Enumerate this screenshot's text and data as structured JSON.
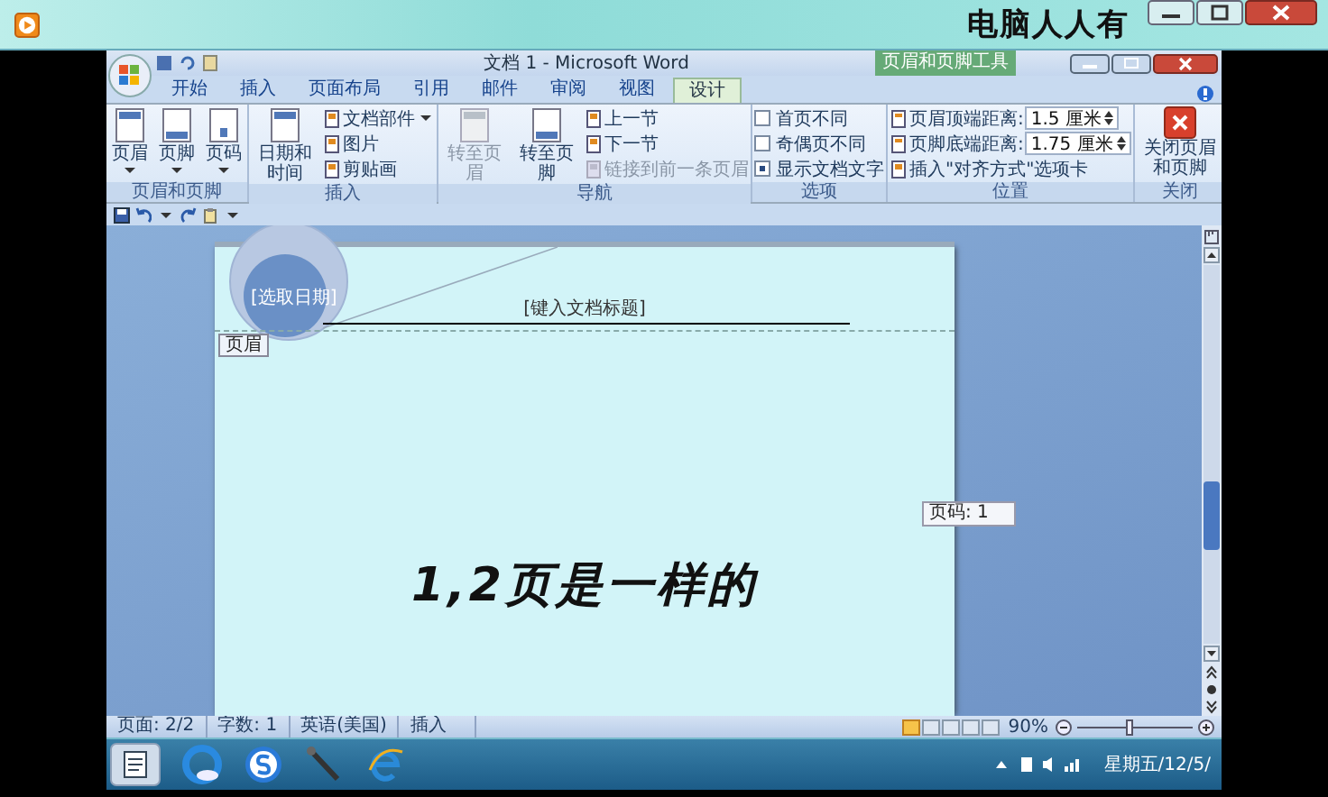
{
  "player": {
    "title": "电脑人人有"
  },
  "word": {
    "title": "文档 1 - Microsoft Word",
    "context_group": "页眉和页脚工具",
    "tabs": [
      {
        "label": "开始",
        "selected": false
      },
      {
        "label": "插入",
        "selected": false
      },
      {
        "label": "页面布局",
        "selected": false
      },
      {
        "label": "引用",
        "selected": false
      },
      {
        "label": "邮件",
        "selected": false
      },
      {
        "label": "审阅",
        "selected": false
      },
      {
        "label": "视图",
        "selected": false
      },
      {
        "label": "设计",
        "selected": true
      }
    ],
    "ribbon_groups": [
      {
        "label": "页眉和页脚",
        "items": [
          {
            "kind": "large",
            "label": "页眉",
            "dropdown": true,
            "disabled": false
          },
          {
            "kind": "large",
            "label": "页脚",
            "dropdown": true,
            "disabled": false
          },
          {
            "kind": "large",
            "label": "页码",
            "dropdown": true,
            "disabled": false
          }
        ]
      },
      {
        "label": "插入",
        "items": [
          {
            "kind": "large",
            "label": "日期和时间",
            "dropdown": false,
            "disabled": false
          },
          {
            "kind": "small",
            "label": "文档部件",
            "dropdown": true,
            "disabled": false
          },
          {
            "kind": "small",
            "label": "图片",
            "dropdown": false,
            "disabled": false
          },
          {
            "kind": "small",
            "label": "剪贴画",
            "dropdown": false,
            "disabled": false
          }
        ]
      },
      {
        "label": "导航",
        "items": [
          {
            "kind": "large",
            "label": "转至页眉",
            "dropdown": false,
            "disabled": true
          },
          {
            "kind": "large",
            "label": "转至页脚",
            "dropdown": false,
            "disabled": false
          },
          {
            "kind": "small",
            "label": "上一节",
            "dropdown": false,
            "disabled": false
          },
          {
            "kind": "small",
            "label": "下一节",
            "dropdown": false,
            "disabled": false
          },
          {
            "kind": "small",
            "label": "链接到前一条页眉",
            "dropdown": false,
            "disabled": true
          }
        ]
      },
      {
        "label": "选项",
        "items": [
          {
            "kind": "check",
            "label": "首页不同",
            "checked": false
          },
          {
            "kind": "check",
            "label": "奇偶页不同",
            "checked": false
          },
          {
            "kind": "check",
            "label": "显示文档文字",
            "checked": true
          }
        ]
      },
      {
        "label": "位置",
        "items": [
          {
            "kind": "spin",
            "label": "页眉顶端距离:",
            "value": "1.5 厘米"
          },
          {
            "kind": "spin",
            "label": "页脚底端距离:",
            "value": "1.75 厘米"
          },
          {
            "kind": "small",
            "label": "插入\"对齐方式\"选项卡",
            "dropdown": false,
            "disabled": false
          }
        ]
      },
      {
        "label": "关闭",
        "items": [
          {
            "kind": "close",
            "label": "关闭页眉和页脚"
          }
        ]
      }
    ],
    "document": {
      "date_field": "[选取日期]",
      "title_field": "[键入文档标题]",
      "header_tag": "页眉",
      "body_text": "1,2页是一样的",
      "tooltip": "页码: 1"
    },
    "status_bar": {
      "items": [
        "页面: 2/2",
        "字数: 1",
        "英语(美国)",
        "插入"
      ],
      "views": [
        {
          "selected": true
        },
        {
          "selected": false
        },
        {
          "selected": false
        },
        {
          "selected": false
        },
        {
          "selected": false
        }
      ],
      "zoom": "90%",
      "zoom_slider": {
        "level": 0.45
      }
    },
    "taskbar": {
      "clock": "星期五/12/5/"
    }
  }
}
